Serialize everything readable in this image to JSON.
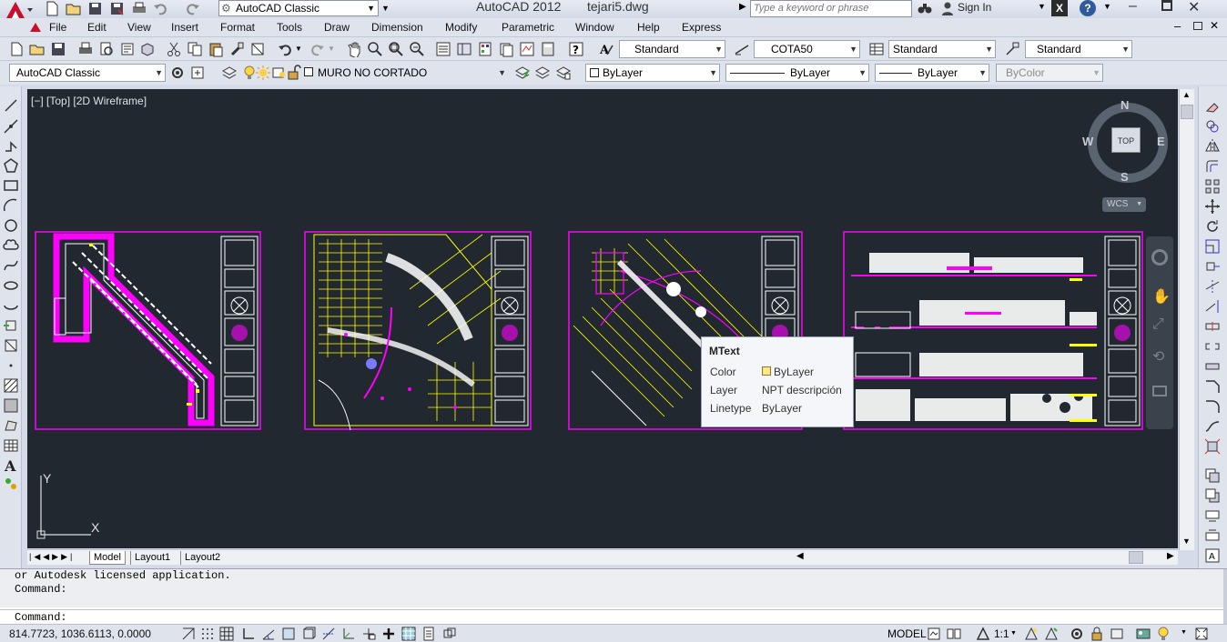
{
  "titlebar": {
    "workspace": "AutoCAD Classic",
    "app_title": "AutoCAD 2012",
    "file_name": "tejari5.dwg",
    "search_placeholder": "Type a keyword or phrase",
    "sign_in": "Sign In"
  },
  "menu": [
    "File",
    "Edit",
    "View",
    "Insert",
    "Format",
    "Tools",
    "Draw",
    "Dimension",
    "Modify",
    "Parametric",
    "Window",
    "Help",
    "Express"
  ],
  "toolbar1": {
    "text_style": "Standard",
    "dim_style": "COTA50",
    "table_style": "Standard",
    "mleader_style": "Standard"
  },
  "toolbar2": {
    "workspace": "AutoCAD Classic",
    "layer": "MURO NO CORTADO",
    "color": "ByLayer",
    "linetype": "ByLayer",
    "lineweight": "ByLayer",
    "plotstyle": "ByColor"
  },
  "viewport": {
    "label": "[−] [Top] [2D Wireframe]",
    "viewcube": {
      "n": "N",
      "s": "S",
      "e": "E",
      "w": "W",
      "top": "TOP",
      "wcs": "WCS"
    },
    "ucs_y": "Y",
    "ucs_x": "X"
  },
  "tooltip": {
    "title": "MText",
    "rows": [
      {
        "key": "Color",
        "value": "ByLayer"
      },
      {
        "key": "Layer",
        "value": "NPT descripción"
      },
      {
        "key": "Linetype",
        "value": "ByLayer"
      }
    ]
  },
  "layout_tabs": [
    "Model",
    "Layout1",
    "Layout2"
  ],
  "command": {
    "history": [
      "or Autodesk licensed application.",
      "Command:"
    ],
    "prompt": "Command:"
  },
  "status": {
    "coords": "814.7723, 1036.6113, 0.0000",
    "model": "MODEL",
    "scale": "1:1"
  },
  "colors": {
    "drawing_bg": "#212830",
    "magenta": "#ff00ff",
    "yellow": "#ffff00",
    "white": "#ffffff"
  }
}
